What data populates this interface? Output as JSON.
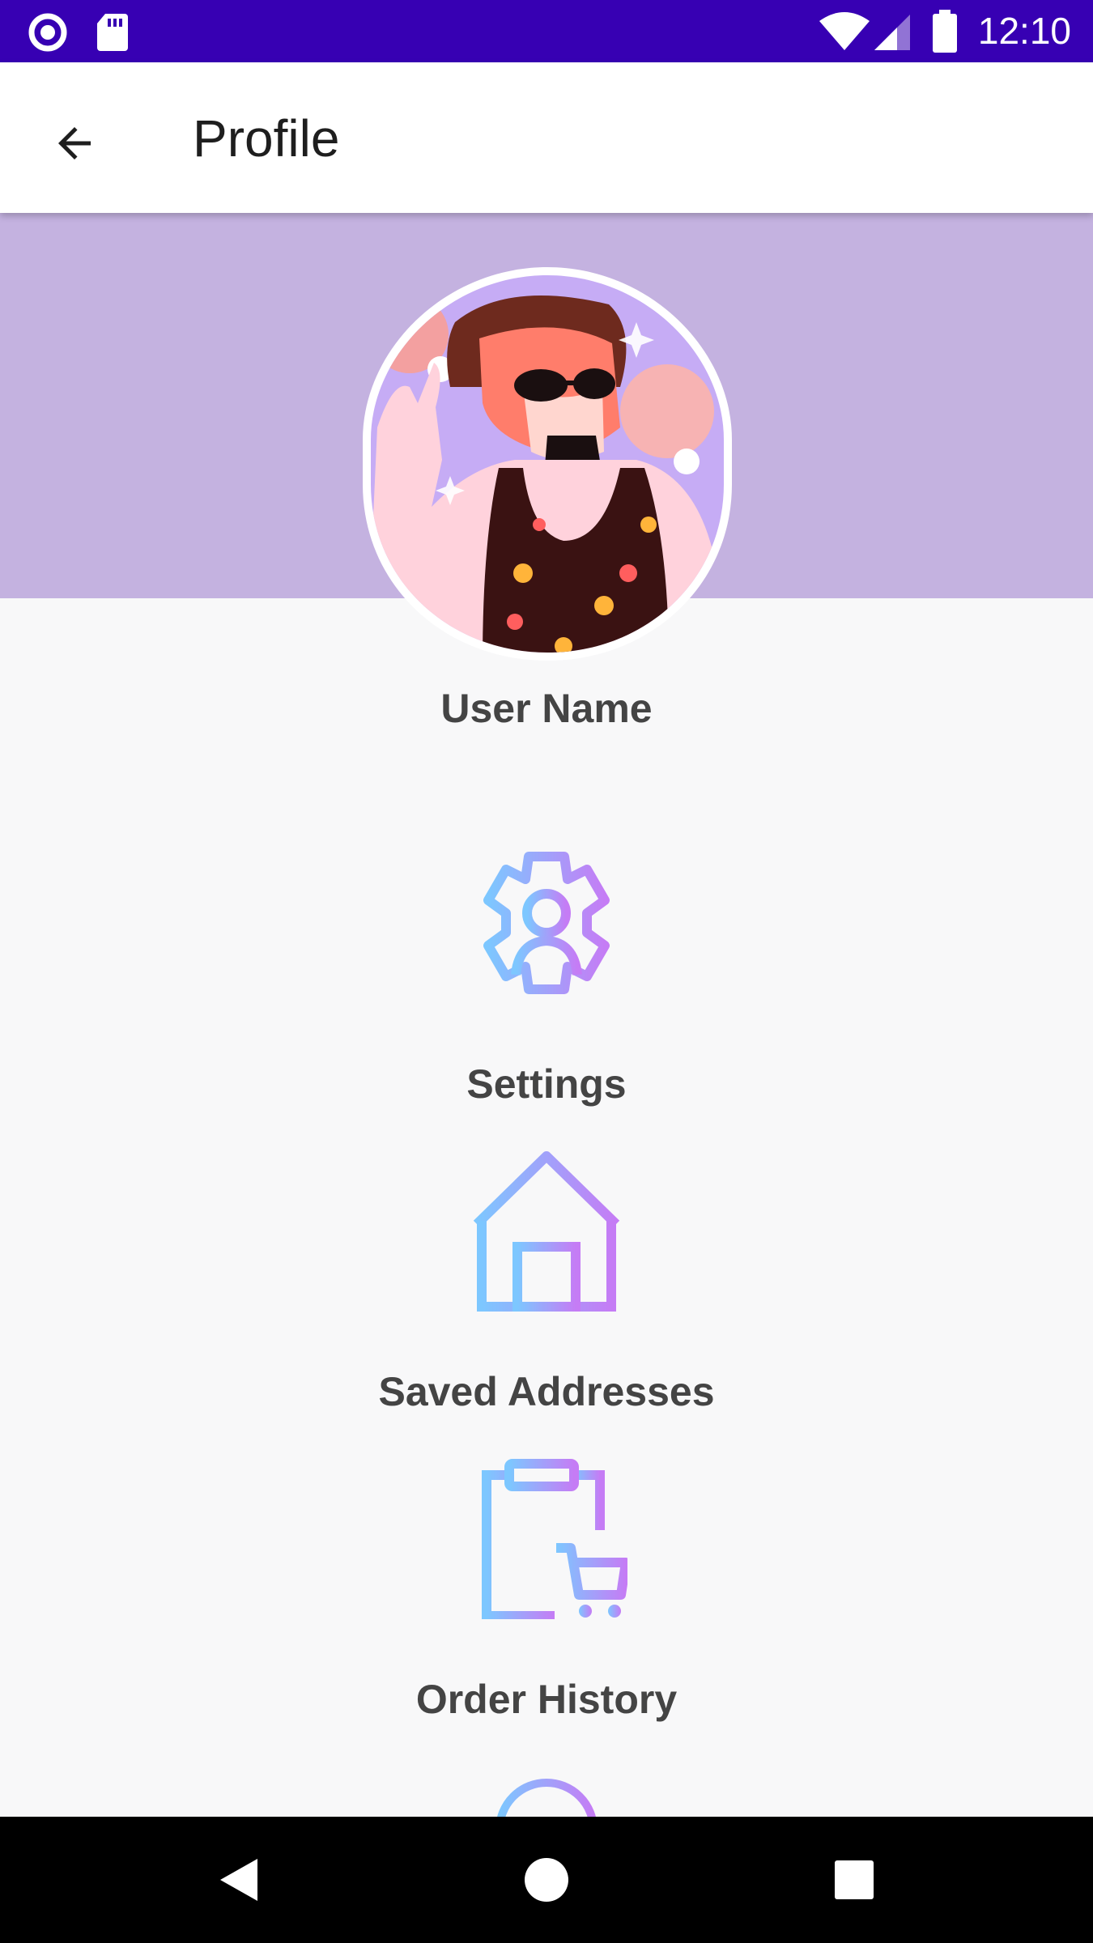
{
  "status_bar": {
    "time": "12:10"
  },
  "app_bar": {
    "title": "Profile",
    "back_icon": "arrow-back-icon"
  },
  "profile": {
    "user_name": "User Name"
  },
  "menu": [
    {
      "label": "Settings",
      "icon": "settings-user-icon"
    },
    {
      "label": "Saved Addresses",
      "icon": "home-icon"
    },
    {
      "label": "Order History",
      "icon": "order-history-icon"
    }
  ],
  "colors": {
    "status_bar": "#3700b3",
    "header_band": "#c4b2e0",
    "icon_gradient_start": "#7dc7ff",
    "icon_gradient_end": "#c57cf5"
  }
}
